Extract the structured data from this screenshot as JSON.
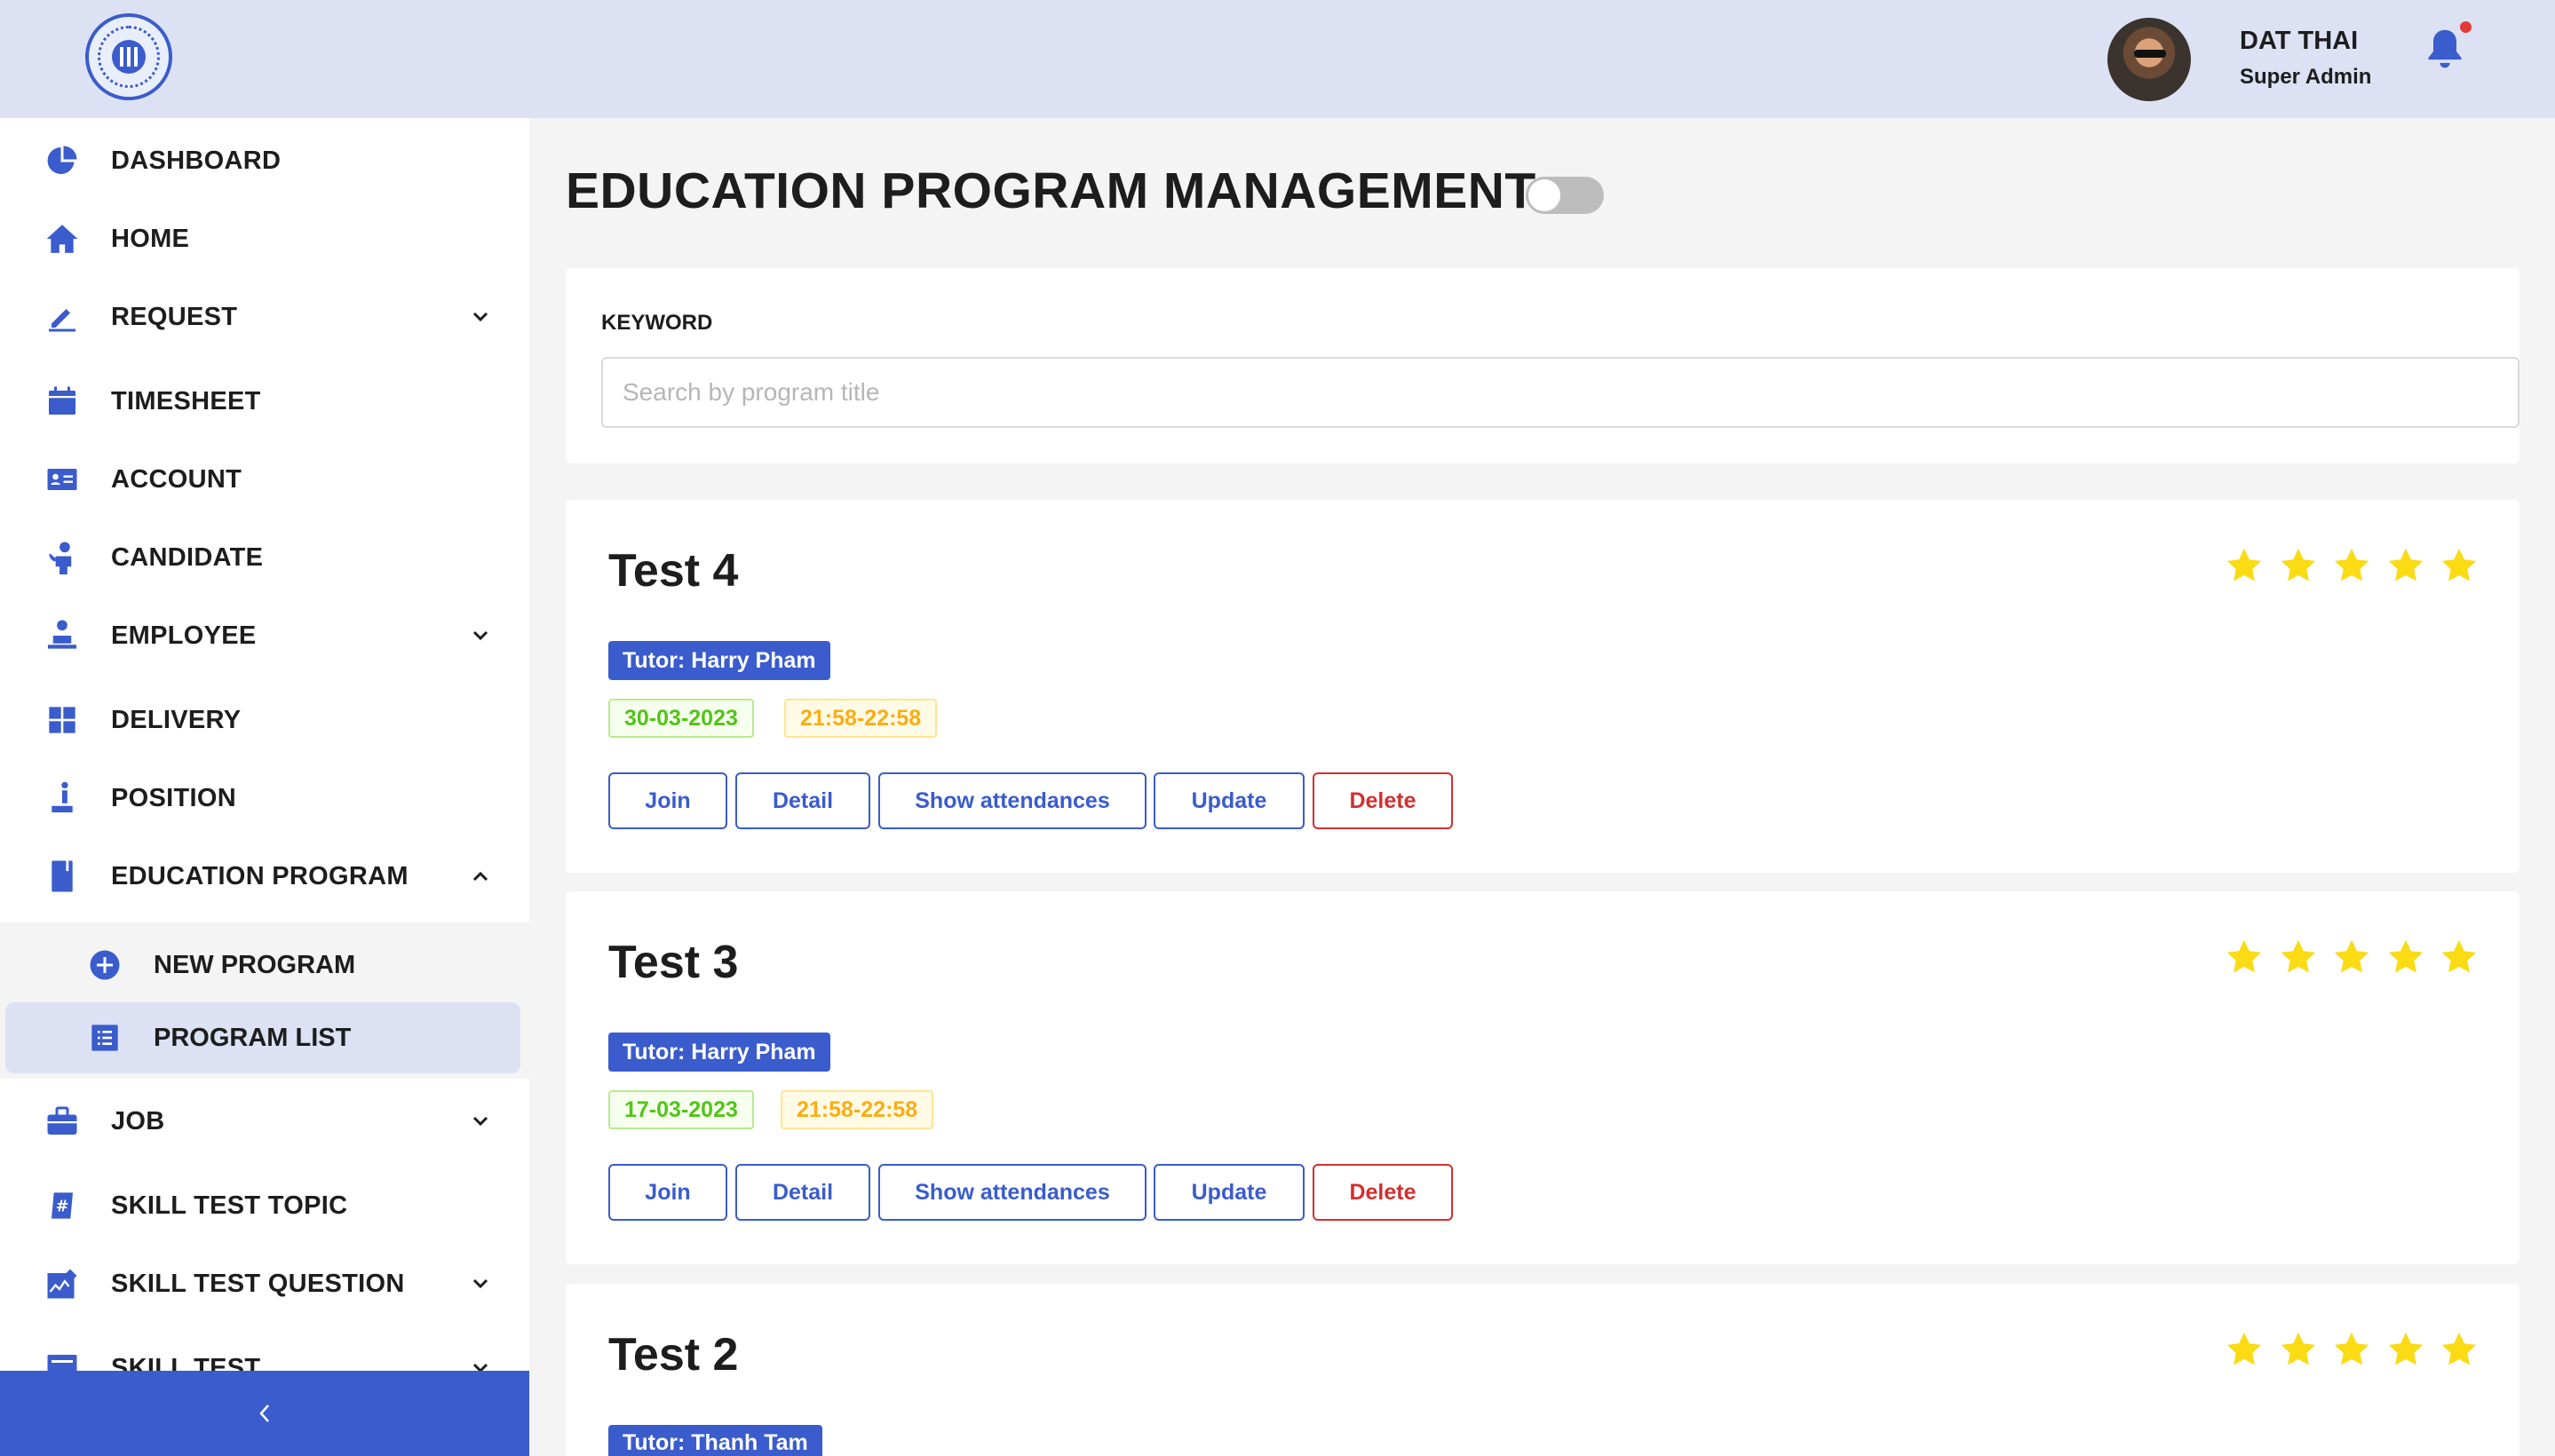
{
  "header": {
    "user_name": "DAT THAI",
    "user_role": "Super Admin",
    "notification_dot_color": "#e53935"
  },
  "sidebar": {
    "items": [
      {
        "label": "DASHBOARD",
        "icon": "pie-chart-icon"
      },
      {
        "label": "HOME",
        "icon": "home-icon"
      },
      {
        "label": "REQUEST",
        "icon": "pencil-icon",
        "expandable": true
      },
      {
        "label": "TIMESHEET",
        "icon": "calendar-icon"
      },
      {
        "label": "ACCOUNT",
        "icon": "id-card-icon"
      },
      {
        "label": "CANDIDATE",
        "icon": "candidate-icon"
      },
      {
        "label": "EMPLOYEE",
        "icon": "employee-icon",
        "expandable": true
      },
      {
        "label": "DELIVERY",
        "icon": "grid-icon"
      },
      {
        "label": "POSITION",
        "icon": "position-icon"
      },
      {
        "label": "EDUCATION PROGRAM",
        "icon": "book-icon",
        "expandable": true,
        "expanded": true
      },
      {
        "label": "JOB",
        "icon": "briefcase-icon",
        "expandable": true
      },
      {
        "label": "SKILL TEST TOPIC",
        "icon": "hashtag-icon"
      },
      {
        "label": "SKILL TEST QUESTION",
        "icon": "chart-icon",
        "expandable": true
      },
      {
        "label": "SKILL TEST",
        "icon": "test-icon",
        "expandable": true
      }
    ],
    "sub_items": [
      {
        "label": "NEW PROGRAM",
        "icon": "plus-circle-icon"
      },
      {
        "label": "PROGRAM LIST",
        "icon": "list-icon",
        "active": true
      }
    ]
  },
  "main": {
    "title": "EDUCATION PROGRAM MANAGEMENT",
    "search": {
      "label": "KEYWORD",
      "placeholder": "Search by program title",
      "value": ""
    },
    "programs": [
      {
        "title": "Test 4",
        "tutor": "Tutor: Harry Pham",
        "date": "30-03-2023",
        "time": "21:58-22:58",
        "rating": 5
      },
      {
        "title": "Test 3",
        "tutor": "Tutor: Harry Pham",
        "date": "17-03-2023",
        "time": "21:58-22:58",
        "rating": 5
      },
      {
        "title": "Test 2",
        "tutor": "Tutor: Thanh Tam",
        "rating": 5
      }
    ],
    "actions": {
      "join": "Join",
      "detail": "Detail",
      "show_attendances": "Show attendances",
      "update": "Update",
      "delete": "Delete"
    }
  },
  "colors": {
    "primary": "#3a5ccc",
    "header_bg": "#dce2f4",
    "star": "#fadb14",
    "danger": "#d32f2f",
    "date_green": "#52c41a",
    "time_orange": "#faad14"
  }
}
